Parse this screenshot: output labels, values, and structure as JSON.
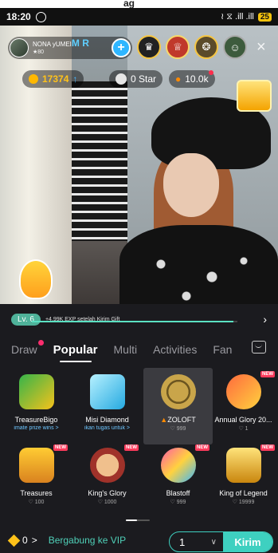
{
  "top_strip_text": "ag",
  "status_bar": {
    "time": "18:20",
    "whatsapp_icon": "whatsapp-icon",
    "signal_text": "≀ ⧖ .ill .ill",
    "battery": "25"
  },
  "host": {
    "name_prefix": "NONA yUMEI",
    "name_highlight": "M R",
    "fans": "★80",
    "follow_label": "+"
  },
  "viewers": [
    "♛",
    "♕",
    "❂",
    "☺"
  ],
  "close_label": "×",
  "stats": {
    "coins": "17374",
    "coins_arrow": "↑",
    "stars": "0 Star",
    "heat": "10.0k"
  },
  "level": {
    "badge": "Lv. 6",
    "text": "+4,99K EXP setelah Kirim Gift",
    "progress": 0.98,
    "chevron": "›"
  },
  "tabs": [
    {
      "label": "Draw",
      "active": false,
      "dot": true
    },
    {
      "label": "Popular",
      "active": true,
      "dot": false
    },
    {
      "label": "Multi",
      "active": false,
      "dot": false
    },
    {
      "label": "Activities",
      "active": false,
      "dot": false
    },
    {
      "label": "Fan",
      "active": false,
      "dot": false
    }
  ],
  "gifts": [
    {
      "name": "TreasureBigo",
      "sub": "imate prize wins >",
      "icon": "treasurebigo",
      "new": false,
      "selected": false,
      "sub_accent": true
    },
    {
      "name": "Misi Diamond",
      "sub": "ikan tugas untuk >",
      "icon": "misidiamond",
      "new": false,
      "selected": false,
      "sub_accent": true
    },
    {
      "name": "ZOLOFT",
      "sub": "♡ 999",
      "icon": "zoloft",
      "new": false,
      "selected": true,
      "sub_accent": false,
      "flame": true
    },
    {
      "name": "Annual Glory 20...",
      "sub": "♡ 1",
      "icon": "annual",
      "new": true,
      "selected": false,
      "sub_accent": false
    },
    {
      "name": "Treasures",
      "sub": "♡ 100",
      "icon": "treasures",
      "new": true,
      "selected": false,
      "sub_accent": false
    },
    {
      "name": "King's Glory",
      "sub": "♡ 1000",
      "icon": "kingsglory",
      "new": true,
      "selected": false,
      "sub_accent": false
    },
    {
      "name": "Blastoff",
      "sub": "♡ 999",
      "icon": "blastoff",
      "new": true,
      "selected": false,
      "sub_accent": false
    },
    {
      "name": "King of Legend",
      "sub": "♡ 19999",
      "icon": "kinglegend",
      "new": true,
      "selected": false,
      "sub_accent": false
    }
  ],
  "new_badge": "NEW",
  "bottom": {
    "balance": "0",
    "balance_chevron": ">",
    "vip_label": "Bergabung ke VIP",
    "quantity": "1",
    "quantity_chevron": "∨",
    "send_label": "Kirim"
  }
}
